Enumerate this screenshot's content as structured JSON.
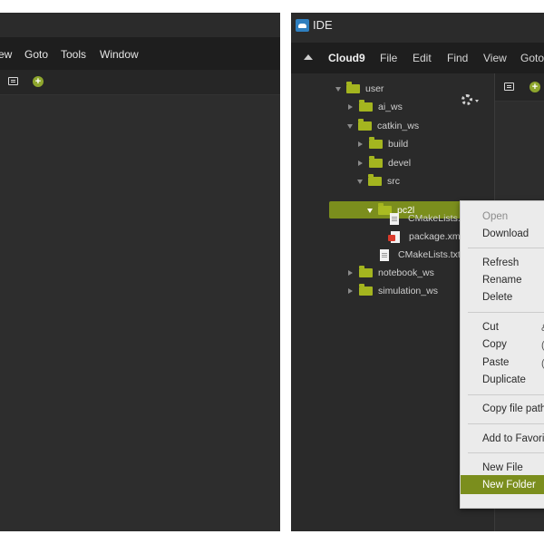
{
  "left_window": {
    "menu": [
      "ew",
      "Goto",
      "Tools",
      "Window"
    ]
  },
  "right_window": {
    "title": "IDE",
    "menu": [
      "Cloud9",
      "File",
      "Edit",
      "Find",
      "View",
      "Goto"
    ],
    "tree": {
      "root": "user",
      "items": [
        {
          "label": "user",
          "type": "folder",
          "state": "expanded"
        },
        {
          "label": "ai_ws",
          "type": "folder",
          "state": "collapsed"
        },
        {
          "label": "catkin_ws",
          "type": "folder",
          "state": "expanded"
        },
        {
          "label": "build",
          "type": "folder",
          "state": "collapsed"
        },
        {
          "label": "devel",
          "type": "folder",
          "state": "collapsed"
        },
        {
          "label": "src",
          "type": "folder",
          "state": "expanded"
        },
        {
          "label": "pc2l",
          "type": "folder",
          "state": "expanded",
          "selected": true
        },
        {
          "label": "CMakeLists.",
          "type": "file"
        },
        {
          "label": "package.xml",
          "type": "xml-file"
        },
        {
          "label": "CMakeLists.txt",
          "type": "file"
        },
        {
          "label": "notebook_ws",
          "type": "folder",
          "state": "collapsed"
        },
        {
          "label": "simulation_ws",
          "type": "folder",
          "state": "collapsed"
        }
      ]
    },
    "context_menu": {
      "items": [
        {
          "label": "Open",
          "disabled": true
        },
        {
          "label": "Download"
        },
        {
          "label": "Refresh"
        },
        {
          "label": "Rename"
        },
        {
          "label": "Delete"
        },
        {
          "label": "Cut",
          "shortcut": "&"
        },
        {
          "label": "Copy",
          "shortcut": "("
        },
        {
          "label": "Paste",
          "shortcut": "("
        },
        {
          "label": "Duplicate"
        },
        {
          "label": "Copy file path"
        },
        {
          "label": "Add to Favorit"
        },
        {
          "label": "New File"
        },
        {
          "label": "New Folder",
          "highlighted": true
        }
      ]
    }
  },
  "colors": {
    "accent_green": "#7b8e1d",
    "folder_green": "#a4b51f",
    "menubar_bg": "#1e1e1e",
    "panel_bg": "#2a2a2a",
    "context_menu_bg": "#ebebeb"
  },
  "icons": [
    "gear-icon",
    "folder-icon",
    "file-icon",
    "xml-file-icon",
    "add-icon",
    "panel-toggle-icon",
    "app-icon",
    "collapse-arrow-icon"
  ]
}
